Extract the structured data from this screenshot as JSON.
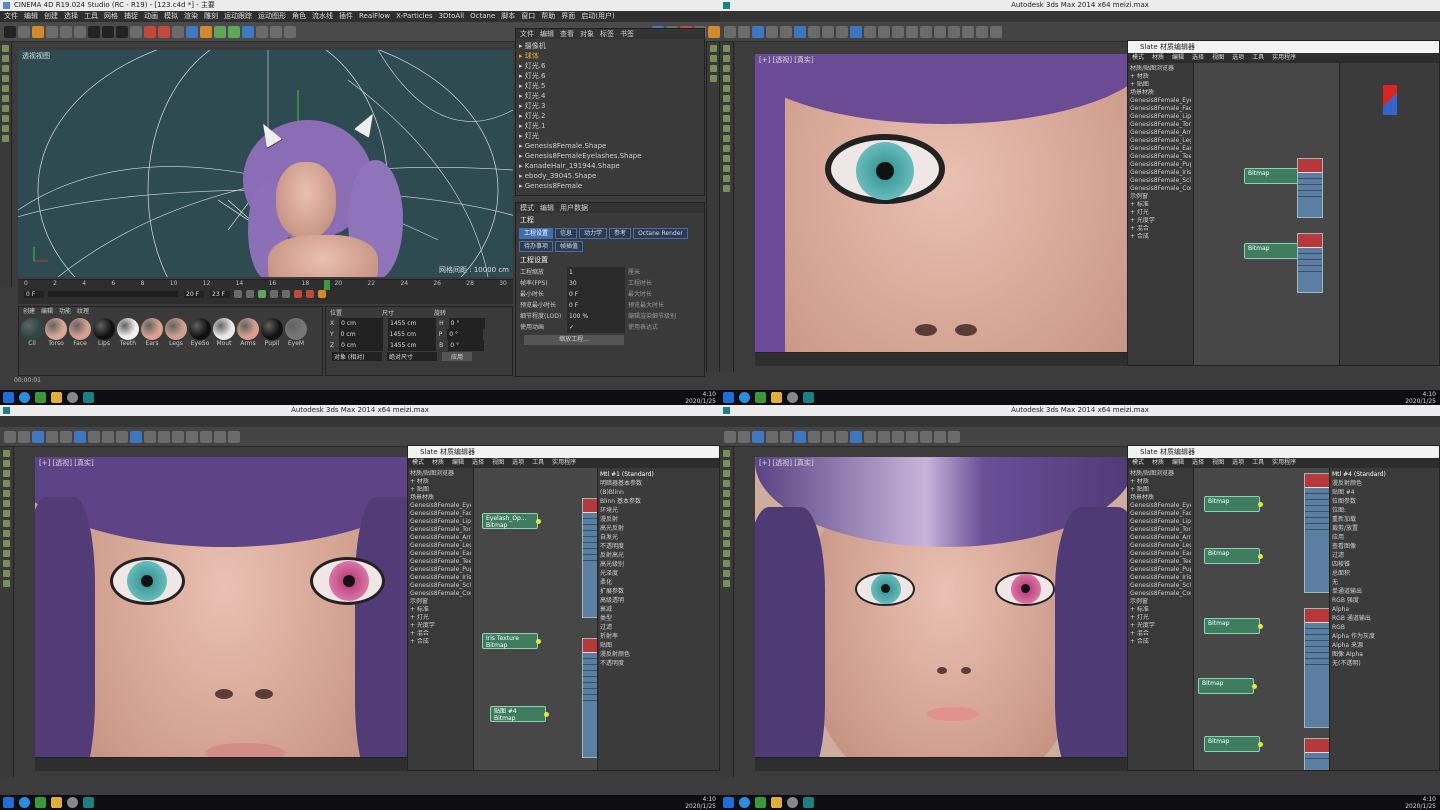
{
  "q1": {
    "title": "CINEMA 4D R19.024 Studio (RC - R19) - [123.c4d *] - 主要",
    "menu": [
      "文件",
      "编辑",
      "创建",
      "选择",
      "工具",
      "网格",
      "捕捉",
      "动画",
      "模拟",
      "渲染",
      "雕刻",
      "运动跟踪",
      "运动图形",
      "角色",
      "流水线",
      "插件",
      "RealFlow",
      "X-Particles",
      "3DtoAll",
      "Octane",
      "脚本",
      "窗口",
      "帮助",
      "界面",
      "启动(用户)"
    ],
    "viewport_menu": [
      "查看",
      "摄像机",
      "显示",
      "选项",
      "过滤",
      "面板",
      "ProRender"
    ],
    "viewport_label": "透视视图",
    "grid_label": "网格间距 : 10000 cm",
    "objects": [
      "摄像机",
      "球体",
      "灯光.6",
      "灯光.6",
      "灯光.5",
      "灯光.4",
      "灯光.3",
      "灯光.2",
      "灯光.1",
      "灯光",
      "Genesis8Female.Shape",
      "Genesis8FemaleEyelashes.Shape",
      "KanadeHair_191944.Shape",
      "ebody_39045.Shape",
      "Genesis8Female"
    ],
    "obj_menu": [
      "文件",
      "编辑",
      "查看",
      "对象",
      "标签",
      "书签"
    ],
    "attr_menu": [
      "模式",
      "编辑",
      "用户数据"
    ],
    "attr_title": "工程",
    "attr_tabs": [
      "工程设置",
      "信息",
      "动力学",
      "参考",
      "Octane Render",
      "待办事项",
      "帧插值"
    ],
    "attr_section": "工程设置",
    "attr_rows": [
      {
        "label": "工程缩放",
        "value": "1",
        "unit": "厘米"
      },
      {
        "label": "帧率(FPS)",
        "value": "30",
        "label2": "工程时长"
      },
      {
        "label": "最小时长",
        "value": "0 F",
        "label2": "最大时长"
      },
      {
        "label": "预览最小时长",
        "value": "0 F",
        "label2": "预览最大时长"
      },
      {
        "label": "细节程度(LOD)",
        "value": "100 %",
        "label2": "编辑渲染细节级别"
      },
      {
        "label": "使用动画",
        "value": "✓",
        "label2": "使用表达式"
      }
    ],
    "scale_button": "缩放工程...",
    "timeline_ticks": [
      "0",
      "2",
      "4",
      "6",
      "8",
      "10",
      "12",
      "14",
      "16",
      "18",
      "20",
      "22",
      "24",
      "26",
      "28",
      "30"
    ],
    "frame_start": "0 F",
    "frame_end": "23 F",
    "frame_current": "20 F",
    "frame_end2": "23 F",
    "mat_menu": [
      "创建",
      "编辑",
      "功能",
      "纹理"
    ],
    "materials": [
      "Cil",
      "Torso",
      "Face",
      "Lips",
      "Teeth",
      "Ears",
      "Legs",
      "EyeSo",
      "Mout",
      "Arms",
      "Pupil",
      "EyeM"
    ],
    "coord_headers": [
      "位置",
      "尺寸",
      "旋转"
    ],
    "coords": [
      {
        "axis": "X",
        "pos": "0 cm",
        "size": "1455 cm",
        "rot_axis": "H",
        "rot": "0 °"
      },
      {
        "axis": "Y",
        "pos": "0 cm",
        "size": "1455 cm",
        "rot_axis": "P",
        "rot": "0 °"
      },
      {
        "axis": "Z",
        "pos": "0 cm",
        "size": "1455 cm",
        "rot_axis": "B",
        "rot": "0 °"
      }
    ],
    "coord_mode": "对象 (相对)",
    "size_mode": "绝对尺寸",
    "apply": "应用",
    "status_time": "00:00:01"
  },
  "q2": {
    "title": "Autodesk 3ds Max 2014 x64    meizi.max",
    "viewport_label": "[+] [透视] [真实]",
    "slate_title": "Slate 材质编辑器",
    "slate_menu": [
      "模式",
      "材质",
      "编辑",
      "选择",
      "视图",
      "选项",
      "工具",
      "实用程序"
    ],
    "browser_items": [
      "材质/贴图浏览器",
      "+ 材质",
      "+ 贴图",
      "场景材质",
      "Genesis8Female_Eyes",
      "Genesis8Female_Face",
      "Genesis8Female_Lips",
      "Genesis8Female_Torso",
      "Genesis8Female_Arms",
      "Genesis8Female_Legs",
      "Genesis8Female_Ears",
      "Genesis8Female_Teeth",
      "Genesis8Female_Pupils",
      "Genesis8Female_Irises",
      "Genesis8Female_Sclera",
      "Genesis8Female_Cornea",
      "示例窗",
      "+ 标准",
      "+ 灯光",
      "+ 光度学",
      "+ 混合",
      "+ 合成"
    ],
    "nodes": [
      "Bitmap",
      "Bitmap"
    ]
  },
  "q3": {
    "title": "Autodesk 3ds Max 2014 x64    meizi.max",
    "viewport_label": "[+] [透视] [真实]",
    "slate_title": "Slate 材质编辑器",
    "slate_menu": [
      "模式",
      "材质",
      "编辑",
      "选择",
      "视图",
      "选项",
      "工具",
      "实用程序"
    ],
    "nodes": [
      {
        "name": "Eyelash_Op...",
        "type": "Bitmap"
      },
      {
        "name": "Iris Texture",
        "type": "Bitmap"
      },
      {
        "name": "贴图 #4",
        "type": "Bitmap"
      }
    ],
    "props_title": "Mtl #1 (Standard)",
    "props_rows": [
      "明暗器基本参数",
      "(B)Blinn",
      "Blinn 基本参数",
      "环境光",
      "漫反射",
      "高光反射",
      "自发光",
      "不透明度",
      "反射高光",
      "高光级别",
      "光泽度",
      "柔化",
      "扩展参数",
      "高级透明",
      "衰减",
      "类型",
      "过滤",
      "折射率",
      "贴图",
      "漫反射颜色",
      "不透明度"
    ]
  },
  "q4": {
    "title": "Autodesk 3ds Max 2014 x64    meizi.max",
    "viewport_label": "[+] [透视] [真实]",
    "slate_title": "Slate 材质编辑器",
    "slate_menu": [
      "模式",
      "材质",
      "编辑",
      "选择",
      "视图",
      "选项",
      "工具",
      "实用程序"
    ],
    "nodes": [
      "Bitmap",
      "Bitmap",
      "Bitmap",
      "Bitmap",
      "Bitmap"
    ],
    "props_title": "Mtl #4 (Standard)",
    "props_rows": [
      "漫反射颜色",
      "贴图 #4",
      "位图参数",
      "位图:",
      "重新加载",
      "裁剪/放置",
      "应用",
      "查看图像",
      "过滤",
      "四棱锥",
      "总面积",
      "无",
      "单通道输出",
      "RGB 强度",
      "Alpha",
      "RGB 通道输出",
      "RGB",
      "Alpha 作为灰度",
      "Alpha 来源",
      "图像 Alpha",
      "无(不透明)"
    ]
  },
  "taskbar": {
    "time": "4:10",
    "date": "2020/1/25"
  }
}
